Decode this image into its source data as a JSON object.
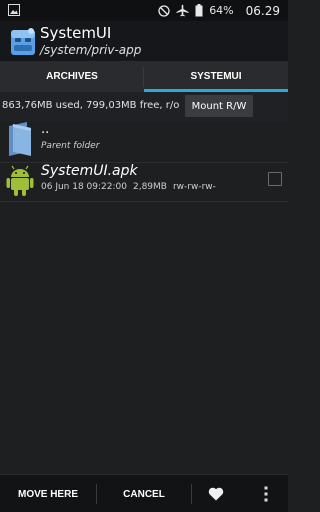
{
  "status_bar": {
    "battery_percent": "64%",
    "time": "06.29",
    "icons": [
      "image-icon",
      "no-disturb-icon",
      "airplane-icon",
      "battery-icon"
    ]
  },
  "app": {
    "title": "SystemUI",
    "subtitle": "/system/priv-app"
  },
  "tabs": [
    {
      "label": "ARCHIVES",
      "active": false
    },
    {
      "label": "SYSTEMUI",
      "active": true
    }
  ],
  "info": {
    "storage_text": "863,76MB used, 799,03MB free, r/o",
    "mount_button_label": "Mount R/W"
  },
  "list": {
    "parent": {
      "name": "..",
      "description": "Parent folder"
    },
    "items": [
      {
        "name": "SystemUI.apk",
        "date": "06 Jun 18 09:22:00",
        "size": "2,89MB",
        "permissions": "rw-rw-rw-",
        "checked": false
      }
    ]
  },
  "bottom_bar": {
    "move_here_label": "MOVE HERE",
    "cancel_label": "CANCEL"
  },
  "colors": {
    "accent": "#2ea8d8",
    "background": "#1e1f21",
    "android_green": "#9fbf3b",
    "folder_blue": "#6a9bd0"
  }
}
